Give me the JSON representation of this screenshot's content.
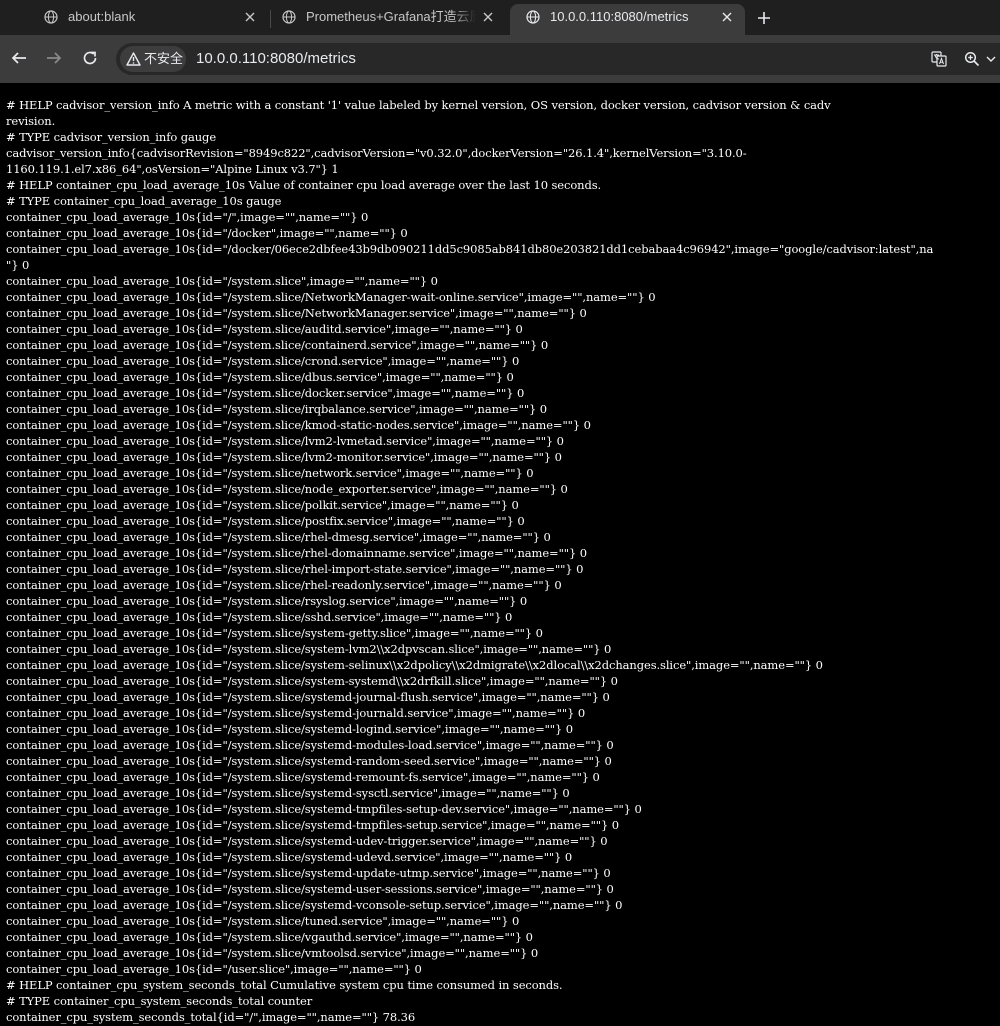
{
  "browser": {
    "tabs": [
      {
        "title": "about:blank",
        "icon": "globe-icon",
        "active": false
      },
      {
        "title": "Prometheus+Grafana打造云原",
        "icon": "globe-icon",
        "active": false
      },
      {
        "title": "10.0.0.110:8080/metrics",
        "icon": "globe-icon",
        "active": true
      }
    ],
    "security_label": "不安全",
    "url": "10.0.0.110:8080/metrics"
  },
  "metrics_lines": [
    "# HELP cadvisor_version_info A metric with a constant '1' value labeled by kernel version, OS version, docker version, cadvisor version & cadv",
    "revision.",
    "# TYPE cadvisor_version_info gauge",
    "cadvisor_version_info{cadvisorRevision=\"8949c822\",cadvisorVersion=\"v0.32.0\",dockerVersion=\"26.1.4\",kernelVersion=\"3.10.0-",
    "1160.119.1.el7.x86_64\",osVersion=\"Alpine Linux v3.7\"} 1",
    "# HELP container_cpu_load_average_10s Value of container cpu load average over the last 10 seconds.",
    "# TYPE container_cpu_load_average_10s gauge",
    "container_cpu_load_average_10s{id=\"/\",image=\"\",name=\"\"} 0",
    "container_cpu_load_average_10s{id=\"/docker\",image=\"\",name=\"\"} 0",
    "container_cpu_load_average_10s{id=\"/docker/06ece2dbfee43b9db090211dd5c9085ab841db80e203821dd1cebabaa4c96942\",image=\"google/cadvisor:latest\",na",
    "\"} 0",
    "container_cpu_load_average_10s{id=\"/system.slice\",image=\"\",name=\"\"} 0",
    "container_cpu_load_average_10s{id=\"/system.slice/NetworkManager-wait-online.service\",image=\"\",name=\"\"} 0",
    "container_cpu_load_average_10s{id=\"/system.slice/NetworkManager.service\",image=\"\",name=\"\"} 0",
    "container_cpu_load_average_10s{id=\"/system.slice/auditd.service\",image=\"\",name=\"\"} 0",
    "container_cpu_load_average_10s{id=\"/system.slice/containerd.service\",image=\"\",name=\"\"} 0",
    "container_cpu_load_average_10s{id=\"/system.slice/crond.service\",image=\"\",name=\"\"} 0",
    "container_cpu_load_average_10s{id=\"/system.slice/dbus.service\",image=\"\",name=\"\"} 0",
    "container_cpu_load_average_10s{id=\"/system.slice/docker.service\",image=\"\",name=\"\"} 0",
    "container_cpu_load_average_10s{id=\"/system.slice/irqbalance.service\",image=\"\",name=\"\"} 0",
    "container_cpu_load_average_10s{id=\"/system.slice/kmod-static-nodes.service\",image=\"\",name=\"\"} 0",
    "container_cpu_load_average_10s{id=\"/system.slice/lvm2-lvmetad.service\",image=\"\",name=\"\"} 0",
    "container_cpu_load_average_10s{id=\"/system.slice/lvm2-monitor.service\",image=\"\",name=\"\"} 0",
    "container_cpu_load_average_10s{id=\"/system.slice/network.service\",image=\"\",name=\"\"} 0",
    "container_cpu_load_average_10s{id=\"/system.slice/node_exporter.service\",image=\"\",name=\"\"} 0",
    "container_cpu_load_average_10s{id=\"/system.slice/polkit.service\",image=\"\",name=\"\"} 0",
    "container_cpu_load_average_10s{id=\"/system.slice/postfix.service\",image=\"\",name=\"\"} 0",
    "container_cpu_load_average_10s{id=\"/system.slice/rhel-dmesg.service\",image=\"\",name=\"\"} 0",
    "container_cpu_load_average_10s{id=\"/system.slice/rhel-domainname.service\",image=\"\",name=\"\"} 0",
    "container_cpu_load_average_10s{id=\"/system.slice/rhel-import-state.service\",image=\"\",name=\"\"} 0",
    "container_cpu_load_average_10s{id=\"/system.slice/rhel-readonly.service\",image=\"\",name=\"\"} 0",
    "container_cpu_load_average_10s{id=\"/system.slice/rsyslog.service\",image=\"\",name=\"\"} 0",
    "container_cpu_load_average_10s{id=\"/system.slice/sshd.service\",image=\"\",name=\"\"} 0",
    "container_cpu_load_average_10s{id=\"/system.slice/system-getty.slice\",image=\"\",name=\"\"} 0",
    "container_cpu_load_average_10s{id=\"/system.slice/system-lvm2\\\\x2dpvscan.slice\",image=\"\",name=\"\"} 0",
    "container_cpu_load_average_10s{id=\"/system.slice/system-selinux\\\\x2dpolicy\\\\x2dmigrate\\\\x2dlocal\\\\x2dchanges.slice\",image=\"\",name=\"\"} 0",
    "container_cpu_load_average_10s{id=\"/system.slice/system-systemd\\\\x2drfkill.slice\",image=\"\",name=\"\"} 0",
    "container_cpu_load_average_10s{id=\"/system.slice/systemd-journal-flush.service\",image=\"\",name=\"\"} 0",
    "container_cpu_load_average_10s{id=\"/system.slice/systemd-journald.service\",image=\"\",name=\"\"} 0",
    "container_cpu_load_average_10s{id=\"/system.slice/systemd-logind.service\",image=\"\",name=\"\"} 0",
    "container_cpu_load_average_10s{id=\"/system.slice/systemd-modules-load.service\",image=\"\",name=\"\"} 0",
    "container_cpu_load_average_10s{id=\"/system.slice/systemd-random-seed.service\",image=\"\",name=\"\"} 0",
    "container_cpu_load_average_10s{id=\"/system.slice/systemd-remount-fs.service\",image=\"\",name=\"\"} 0",
    "container_cpu_load_average_10s{id=\"/system.slice/systemd-sysctl.service\",image=\"\",name=\"\"} 0",
    "container_cpu_load_average_10s{id=\"/system.slice/systemd-tmpfiles-setup-dev.service\",image=\"\",name=\"\"} 0",
    "container_cpu_load_average_10s{id=\"/system.slice/systemd-tmpfiles-setup.service\",image=\"\",name=\"\"} 0",
    "container_cpu_load_average_10s{id=\"/system.slice/systemd-udev-trigger.service\",image=\"\",name=\"\"} 0",
    "container_cpu_load_average_10s{id=\"/system.slice/systemd-udevd.service\",image=\"\",name=\"\"} 0",
    "container_cpu_load_average_10s{id=\"/system.slice/systemd-update-utmp.service\",image=\"\",name=\"\"} 0",
    "container_cpu_load_average_10s{id=\"/system.slice/systemd-user-sessions.service\",image=\"\",name=\"\"} 0",
    "container_cpu_load_average_10s{id=\"/system.slice/systemd-vconsole-setup.service\",image=\"\",name=\"\"} 0",
    "container_cpu_load_average_10s{id=\"/system.slice/tuned.service\",image=\"\",name=\"\"} 0",
    "container_cpu_load_average_10s{id=\"/system.slice/vgauthd.service\",image=\"\",name=\"\"} 0",
    "container_cpu_load_average_10s{id=\"/system.slice/vmtoolsd.service\",image=\"\",name=\"\"} 0",
    "container_cpu_load_average_10s{id=\"/user.slice\",image=\"\",name=\"\"} 0",
    "# HELP container_cpu_system_seconds_total Cumulative system cpu time consumed in seconds.",
    "# TYPE container_cpu_system_seconds_total counter",
    "container_cpu_system_seconds_total{id=\"/\",image=\"\",name=\"\"} 78.36"
  ]
}
